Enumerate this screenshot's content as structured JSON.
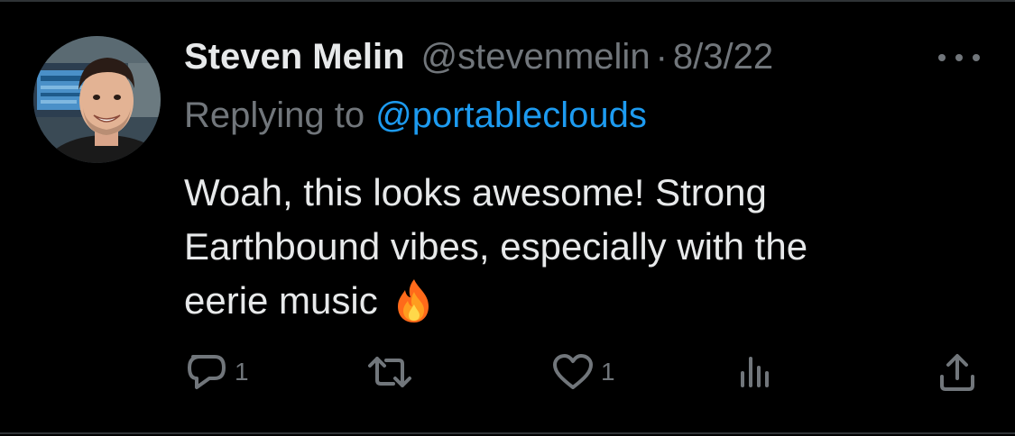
{
  "tweet": {
    "display_name": "Steven Melin",
    "handle": "@stevenmelin",
    "separator": "·",
    "date": "8/3/22",
    "reply_prefix": "Replying to",
    "reply_to": "@portableclouds",
    "text_lines": [
      "Woah, this looks awesome! Strong",
      "Earthbound vibes, especially with the",
      "eerie music"
    ],
    "emoji": "fire-icon"
  },
  "actions": {
    "reply_count": "1",
    "retweet_count": "",
    "like_count": "1",
    "views_count": ""
  },
  "colors": {
    "background": "#000000",
    "text_primary": "#e7e9ea",
    "text_secondary": "#71767b",
    "link": "#1d9bf0",
    "border": "#2f3336"
  }
}
